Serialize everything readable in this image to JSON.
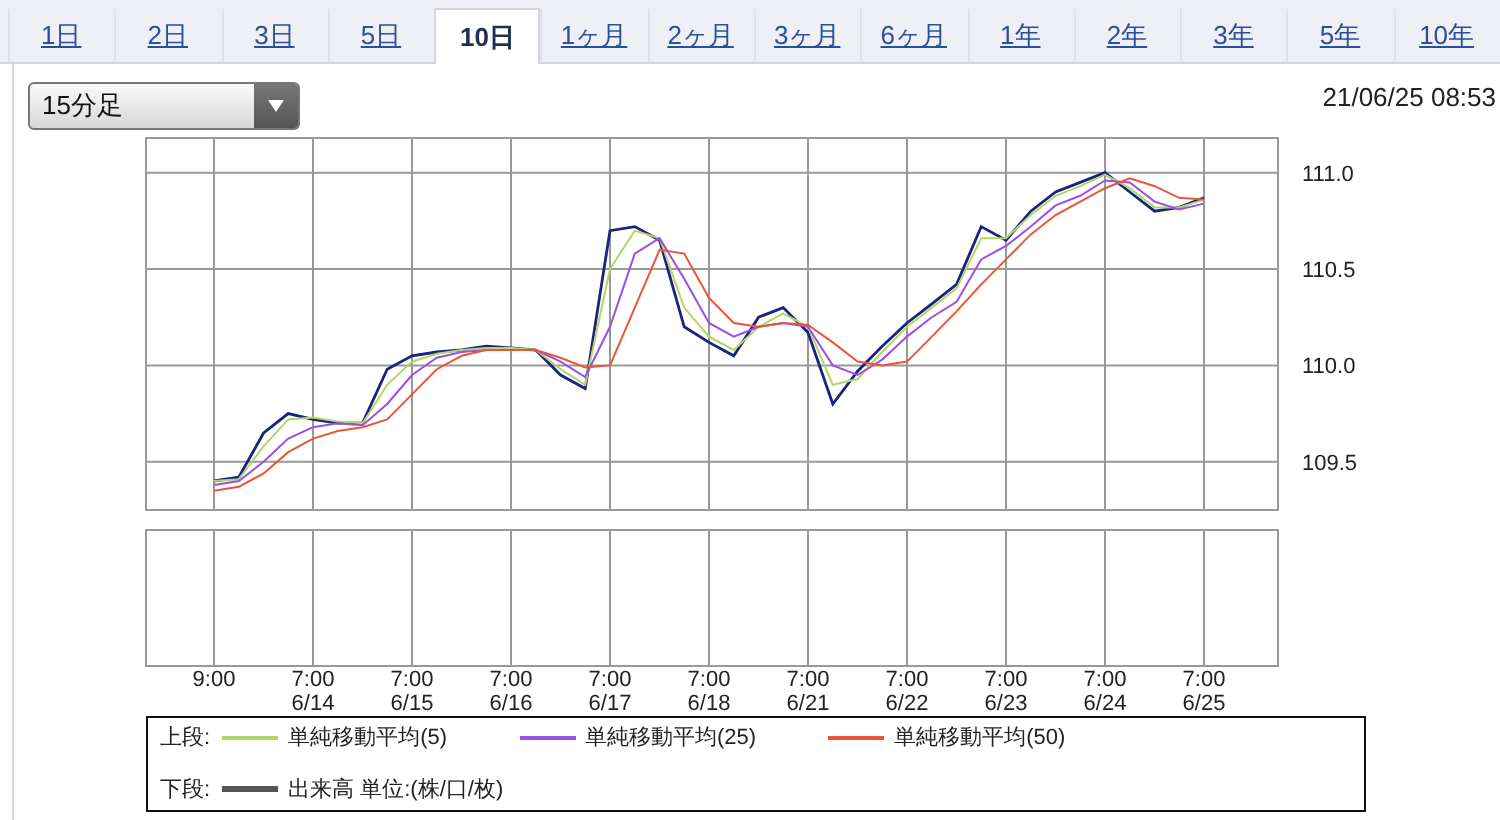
{
  "tabs": [
    {
      "label": "1日",
      "selected": false
    },
    {
      "label": "2日",
      "selected": false
    },
    {
      "label": "3日",
      "selected": false
    },
    {
      "label": "5日",
      "selected": false
    },
    {
      "label": "10日",
      "selected": true
    },
    {
      "label": "1ヶ月",
      "selected": false
    },
    {
      "label": "2ヶ月",
      "selected": false
    },
    {
      "label": "3ヶ月",
      "selected": false
    },
    {
      "label": "6ヶ月",
      "selected": false
    },
    {
      "label": "1年",
      "selected": false
    },
    {
      "label": "2年",
      "selected": false
    },
    {
      "label": "3年",
      "selected": false
    },
    {
      "label": "5年",
      "selected": false
    },
    {
      "label": "10年",
      "selected": false
    }
  ],
  "interval_select": {
    "value": "15分足"
  },
  "timestamp": "21/06/25 08:53",
  "chart_data": {
    "type": "line",
    "grid": true,
    "ylim": [
      109.25,
      111.18
    ],
    "yticks": [
      {
        "value": 109.5,
        "label": "109.5"
      },
      {
        "value": 110,
        "label": "110.0"
      },
      {
        "value": 110.5,
        "label": "110.5"
      },
      {
        "value": 111,
        "label": "111.0"
      }
    ],
    "series": [
      {
        "color": "#1a237e",
        "values": [
          109.4,
          109.42,
          109.65,
          109.75,
          109.72,
          109.7,
          109.7,
          109.98,
          110.05,
          110.07,
          110.08,
          110.1,
          110.09,
          110.08,
          109.95,
          109.88,
          110.7,
          110.72,
          110.65,
          110.2,
          110.12,
          110.05,
          110.25,
          110.3,
          110.17,
          109.8,
          109.97,
          110.1,
          110.22,
          110.32,
          110.42,
          110.72,
          110.65,
          110.8,
          110.9,
          110.95,
          111.0,
          110.9,
          110.8,
          110.82,
          110.87
        ]
      },
      {
        "name": "単純移動平均(5)",
        "color": "#b5d46a",
        "values": [
          109.4,
          109.41,
          109.58,
          109.72,
          109.73,
          109.71,
          109.7,
          109.9,
          110.02,
          110.06,
          110.08,
          110.09,
          110.09,
          110.08,
          109.98,
          109.9,
          110.5,
          110.7,
          110.66,
          110.3,
          110.15,
          110.08,
          110.2,
          110.27,
          110.2,
          109.9,
          109.93,
          110.07,
          110.2,
          110.3,
          110.4,
          110.66,
          110.66,
          110.78,
          110.88,
          110.93,
          110.99,
          110.92,
          110.82,
          110.82,
          110.86
        ]
      },
      {
        "name": "単純移動平均(25)",
        "color": "#9a50e6",
        "values": [
          109.38,
          109.4,
          109.5,
          109.62,
          109.68,
          109.7,
          109.69,
          109.8,
          109.95,
          110.04,
          110.07,
          110.08,
          110.08,
          110.08,
          110.02,
          109.94,
          110.2,
          110.58,
          110.66,
          110.45,
          110.22,
          110.15,
          110.2,
          110.22,
          110.2,
          110.0,
          109.95,
          110.03,
          110.15,
          110.25,
          110.33,
          110.55,
          110.62,
          110.72,
          110.83,
          110.88,
          110.96,
          110.95,
          110.85,
          110.81,
          110.84
        ]
      },
      {
        "name": "単純移動平均(50)",
        "color": "#e8553a",
        "values": [
          109.35,
          109.37,
          109.44,
          109.55,
          109.62,
          109.66,
          109.68,
          109.72,
          109.85,
          109.98,
          110.05,
          110.08,
          110.08,
          110.08,
          110.04,
          109.99,
          110.0,
          110.3,
          110.6,
          110.58,
          110.35,
          110.22,
          110.2,
          110.22,
          110.21,
          110.12,
          110.02,
          110.0,
          110.02,
          110.15,
          110.28,
          110.42,
          110.55,
          110.68,
          110.78,
          110.85,
          110.92,
          110.97,
          110.93,
          110.87,
          110.86
        ]
      }
    ]
  },
  "time_axis": [
    "9:00",
    "7:00\n6/14",
    "7:00\n6/15",
    "7:00\n6/16",
    "7:00\n6/17",
    "7:00\n6/18",
    "7:00\n6/21",
    "7:00\n6/22",
    "7:00\n6/23",
    "7:00\n6/24",
    "7:00\n6/25"
  ],
  "legend": {
    "upper_label": "上段:",
    "lower_label": "下段:",
    "lower_items": [
      {
        "label": "出来高 単位:(株/口/枚)",
        "color": "#555555"
      }
    ]
  }
}
